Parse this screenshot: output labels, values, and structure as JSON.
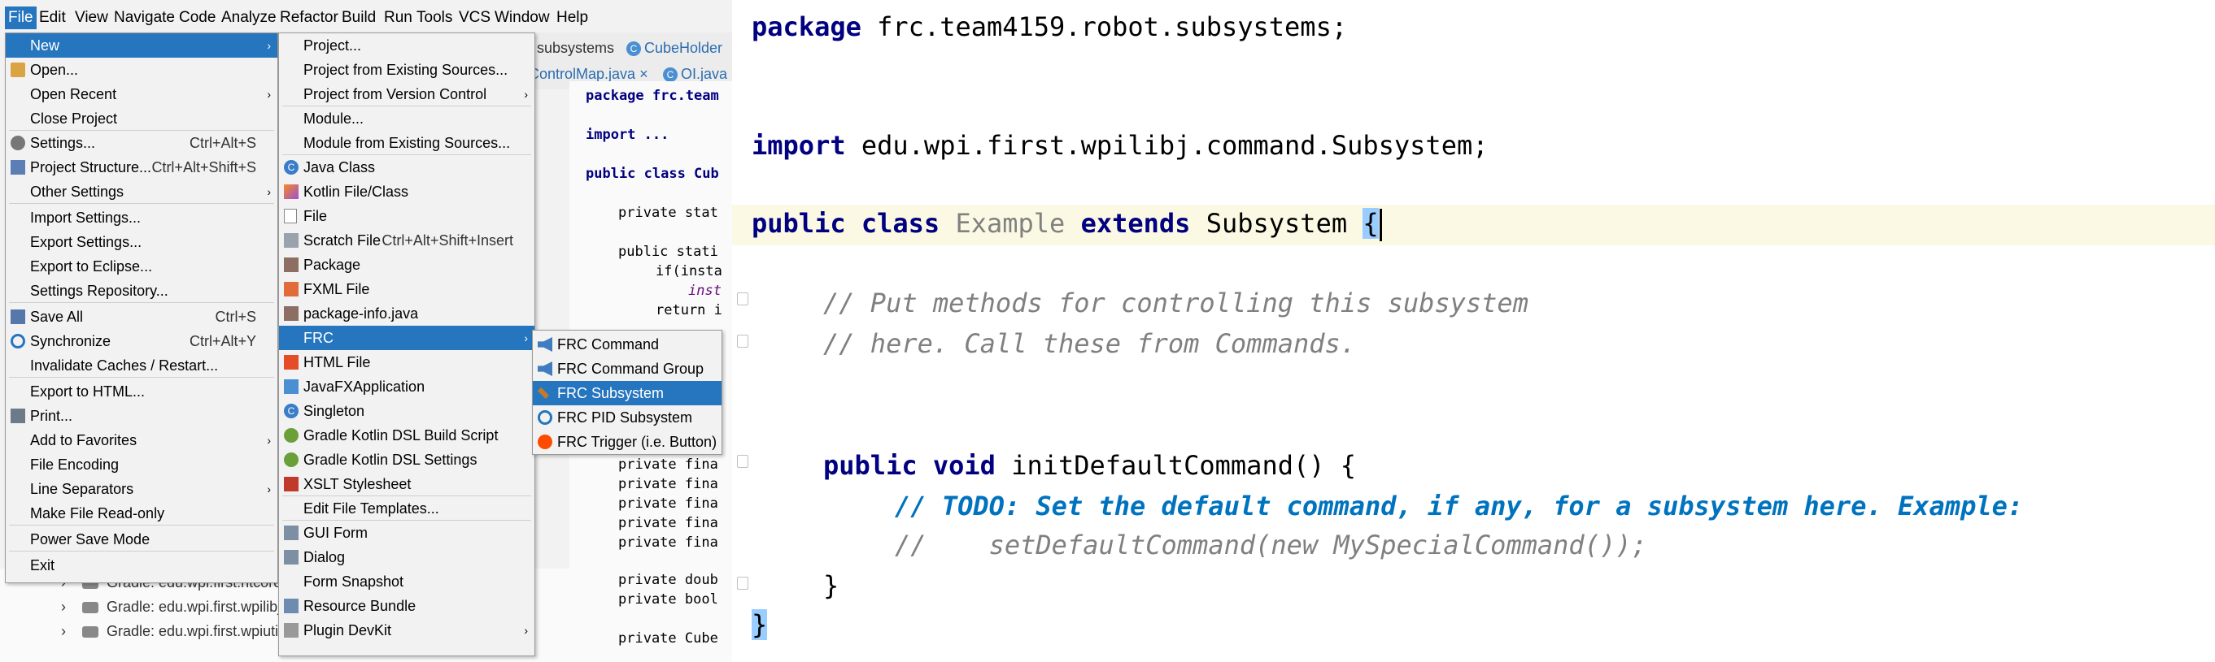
{
  "menubar": [
    "File",
    "Edit",
    "View",
    "Navigate",
    "Code",
    "Analyze",
    "Refactor",
    "Build",
    "Run",
    "Tools",
    "VCS",
    "Window",
    "Help"
  ],
  "ide": {
    "breadcrumb_subsystems": "subsystems",
    "tab_cubeholder": "CubeHolder",
    "tab_controlmap": "ControlMap.java",
    "tab_oi": "OI.java",
    "code_lines": [
      "package frc.team",
      "import ...",
      "public class Cub",
      "private stat",
      "public stati",
      "if(insta",
      "inst",
      "return i",
      "private fina",
      "private fina",
      "private fina",
      "private fina",
      "private fina",
      "private doub",
      "private bool",
      "private Cube"
    ],
    "tree_items": [
      "Gradle: edu.wpi.first.ntcore",
      "Gradle: edu.wpi.first.wpilibj",
      "Gradle: edu.wpi.first.wpiuti"
    ]
  },
  "file_menu": [
    {
      "label": "New",
      "shortcut": "",
      "arrow": true,
      "icon": ""
    },
    {
      "label": "Open...",
      "shortcut": "",
      "arrow": false,
      "icon": "folder-icon"
    },
    {
      "label": "Open Recent",
      "shortcut": "",
      "arrow": true,
      "icon": ""
    },
    {
      "label": "Close Project",
      "shortcut": "",
      "arrow": false,
      "icon": ""
    },
    {
      "label": "Settings...",
      "shortcut": "Ctrl+Alt+S",
      "arrow": false,
      "icon": "settings-icon"
    },
    {
      "label": "Project Structure...",
      "shortcut": "Ctrl+Alt+Shift+S",
      "arrow": false,
      "icon": "project-structure-icon"
    },
    {
      "label": "Other Settings",
      "shortcut": "",
      "arrow": true,
      "icon": ""
    },
    {
      "label": "Import Settings...",
      "shortcut": "",
      "arrow": false,
      "icon": ""
    },
    {
      "label": "Export Settings...",
      "shortcut": "",
      "arrow": false,
      "icon": ""
    },
    {
      "label": "Export to Eclipse...",
      "shortcut": "",
      "arrow": false,
      "icon": ""
    },
    {
      "label": "Settings Repository...",
      "shortcut": "",
      "arrow": false,
      "icon": ""
    },
    {
      "label": "Save All",
      "shortcut": "Ctrl+S",
      "arrow": false,
      "icon": "save-icon"
    },
    {
      "label": "Synchronize",
      "shortcut": "Ctrl+Alt+Y",
      "arrow": false,
      "icon": "sync-icon"
    },
    {
      "label": "Invalidate Caches / Restart...",
      "shortcut": "",
      "arrow": false,
      "icon": ""
    },
    {
      "label": "Export to HTML...",
      "shortcut": "",
      "arrow": false,
      "icon": ""
    },
    {
      "label": "Print...",
      "shortcut": "",
      "arrow": false,
      "icon": "print-icon"
    },
    {
      "label": "Add to Favorites",
      "shortcut": "",
      "arrow": true,
      "icon": ""
    },
    {
      "label": "File Encoding",
      "shortcut": "",
      "arrow": false,
      "icon": ""
    },
    {
      "label": "Line Separators",
      "shortcut": "",
      "arrow": true,
      "icon": ""
    },
    {
      "label": "Make File Read-only",
      "shortcut": "",
      "arrow": false,
      "icon": ""
    },
    {
      "label": "Power Save Mode",
      "shortcut": "",
      "arrow": false,
      "icon": ""
    },
    {
      "label": "Exit",
      "shortcut": "",
      "arrow": false,
      "icon": ""
    }
  ],
  "new_menu": [
    {
      "label": "Project...",
      "shortcut": "",
      "arrow": false,
      "icon": ""
    },
    {
      "label": "Project from Existing Sources...",
      "shortcut": "",
      "arrow": false,
      "icon": ""
    },
    {
      "label": "Project from Version Control",
      "shortcut": "",
      "arrow": true,
      "icon": ""
    },
    {
      "label": "Module...",
      "shortcut": "",
      "arrow": false,
      "icon": ""
    },
    {
      "label": "Module from Existing Sources...",
      "shortcut": "",
      "arrow": false,
      "icon": ""
    },
    {
      "label": "Java Class",
      "shortcut": "",
      "arrow": false,
      "icon": "java-class-icon"
    },
    {
      "label": "Kotlin File/Class",
      "shortcut": "",
      "arrow": false,
      "icon": "kotlin-icon"
    },
    {
      "label": "File",
      "shortcut": "",
      "arrow": false,
      "icon": "file-icon"
    },
    {
      "label": "Scratch File",
      "shortcut": "Ctrl+Alt+Shift+Insert",
      "arrow": false,
      "icon": "scratch-file-icon"
    },
    {
      "label": "Package",
      "shortcut": "",
      "arrow": false,
      "icon": "package-icon"
    },
    {
      "label": "FXML File",
      "shortcut": "",
      "arrow": false,
      "icon": "fxml-icon"
    },
    {
      "label": "package-info.java",
      "shortcut": "",
      "arrow": false,
      "icon": "package-icon"
    },
    {
      "label": "FRC",
      "shortcut": "",
      "arrow": true,
      "icon": "frc-icon"
    },
    {
      "label": "HTML File",
      "shortcut": "",
      "arrow": false,
      "icon": "html-icon"
    },
    {
      "label": "JavaFXApplication",
      "shortcut": "",
      "arrow": false,
      "icon": "javafx-icon"
    },
    {
      "label": "Singleton",
      "shortcut": "",
      "arrow": false,
      "icon": "java-class-icon"
    },
    {
      "label": "Gradle Kotlin DSL Build Script",
      "shortcut": "",
      "arrow": false,
      "icon": "gradle-icon"
    },
    {
      "label": "Gradle Kotlin DSL Settings",
      "shortcut": "",
      "arrow": false,
      "icon": "gradle-icon"
    },
    {
      "label": "XSLT Stylesheet",
      "shortcut": "",
      "arrow": false,
      "icon": "xslt-icon"
    },
    {
      "label": "Edit File Templates...",
      "shortcut": "",
      "arrow": false,
      "icon": ""
    },
    {
      "label": "GUI Form",
      "shortcut": "",
      "arrow": false,
      "icon": "form-icon"
    },
    {
      "label": "Dialog",
      "shortcut": "",
      "arrow": false,
      "icon": "form-icon"
    },
    {
      "label": "Form Snapshot",
      "shortcut": "",
      "arrow": false,
      "icon": ""
    },
    {
      "label": "Resource Bundle",
      "shortcut": "",
      "arrow": false,
      "icon": "resource-bundle-icon"
    },
    {
      "label": "Plugin DevKit",
      "shortcut": "",
      "arrow": true,
      "icon": "plugin-icon"
    }
  ],
  "frc_menu": [
    {
      "label": "FRC Command",
      "icon": "command-icon"
    },
    {
      "label": "FRC Command Group",
      "icon": "command-icon"
    },
    {
      "label": "FRC Subsystem",
      "icon": "subsystem-icon"
    },
    {
      "label": "FRC PID Subsystem",
      "icon": "pid-subsystem-icon"
    },
    {
      "label": "FRC Trigger (i.e. Button)",
      "icon": "trigger-icon"
    }
  ],
  "code": {
    "package_kw": "package",
    "package_name": "frc.team4159.robot.subsystems;",
    "import_kw": "import",
    "import_name": "edu.wpi.first.wpilibj.command.Subsystem;",
    "public_kw": "public",
    "class_kw": "class",
    "class_name": "Example",
    "extends_kw": "extends",
    "super_name": "Subsystem",
    "open_brace": "{",
    "comment1": "// Put methods for controlling this subsystem",
    "comment2": "// here. Call these from Commands.",
    "void_kw": "void",
    "method_sig": "initDefaultCommand() {",
    "todo_prefix": "// ",
    "todo_text": "TODO: Set the default command, if any, for a subsystem here. Example:",
    "comment3": "//    setDefaultCommand(new MySpecialCommand());",
    "method_close": "}",
    "class_close": "}"
  },
  "colors": {
    "selection": "#2675bf",
    "keyword": "#000080",
    "comment": "#808080",
    "todo": "#0073bf",
    "caret_line": "#fbf9e4",
    "brace_match": "#99ccff"
  }
}
